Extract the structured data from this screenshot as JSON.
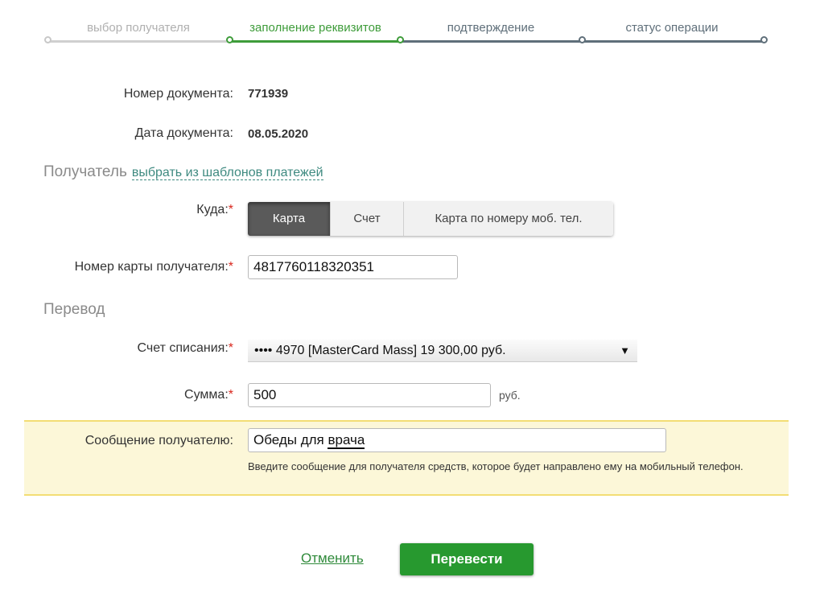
{
  "stepper": {
    "steps": [
      {
        "label": "выбор получателя",
        "state": "done"
      },
      {
        "label": "заполнение реквизитов",
        "state": "active"
      },
      {
        "label": "подтверждение",
        "state": "future"
      },
      {
        "label": "статус операции",
        "state": "future"
      }
    ]
  },
  "document": {
    "number_label": "Номер документа:",
    "number_value": "771939",
    "date_label": "Дата документа:",
    "date_value": "08.05.2020"
  },
  "recipient": {
    "section_title": "Получатель",
    "templates_link": "выбрать из шаблонов платежей",
    "where_label": "Куда:",
    "required_mark": "*",
    "where_options": [
      "Карта",
      "Счет",
      "Карта по номеру моб. тел."
    ],
    "where_selected": "Карта",
    "card_label": "Номер карты получателя:",
    "card_value": "4817760118320351"
  },
  "transfer": {
    "section_title": "Перевод",
    "account_label": "Счет списания:",
    "account_value": "•••• 4970 [MasterCard Mass] 19 300,00 руб.",
    "amount_label": "Сумма:",
    "amount_value": "500",
    "amount_unit": "руб.",
    "message_label": "Сообщение получателю:",
    "message_value_prefix": "Обеды для ",
    "message_value_word": "врача",
    "message_hint": "Введите сообщение для получателя средств, которое будет направлено ему на мобильный телефон."
  },
  "actions": {
    "cancel_label": "Отменить",
    "submit_label": "Перевести"
  },
  "colors": {
    "accent_green": "#3e9c3a",
    "button_green": "#27992f",
    "required_red": "#d9261c",
    "highlight_bg": "#fcf7d8"
  }
}
